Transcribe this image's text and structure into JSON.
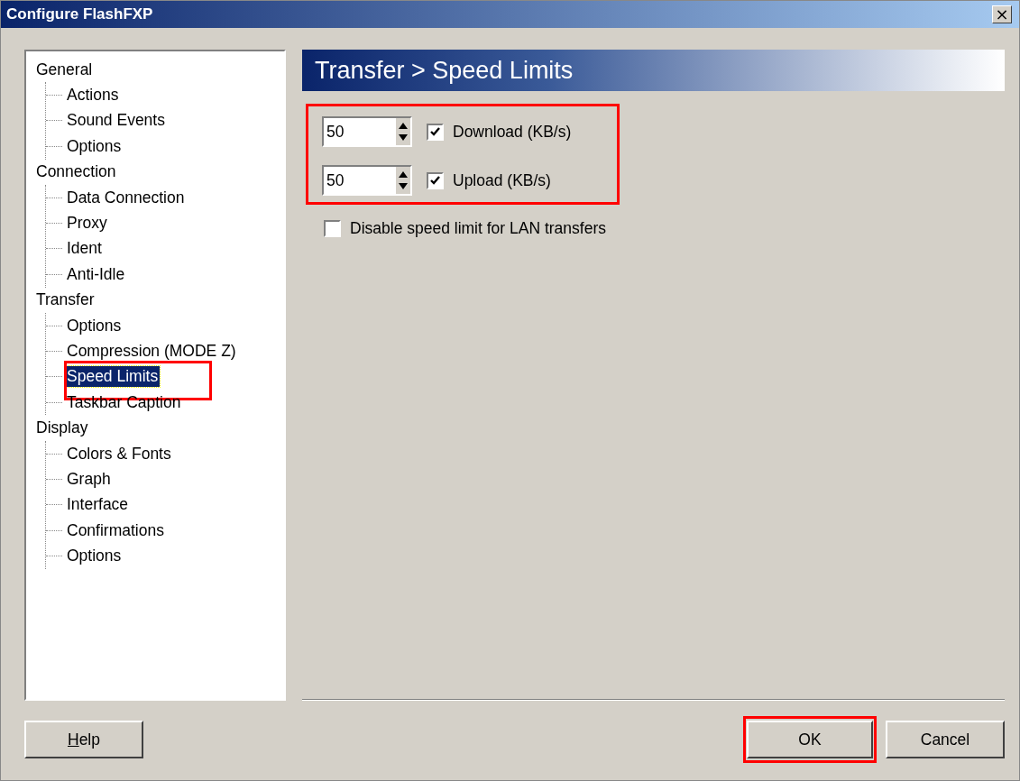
{
  "window": {
    "title": "Configure FlashFXP",
    "close": "×"
  },
  "tree": [
    {
      "label": "General",
      "selected": false,
      "children": [
        {
          "label": "Actions",
          "selected": false
        },
        {
          "label": "Sound Events",
          "selected": false
        },
        {
          "label": "Options",
          "selected": false
        }
      ]
    },
    {
      "label": "Connection",
      "selected": false,
      "children": [
        {
          "label": "Data Connection",
          "selected": false
        },
        {
          "label": "Proxy",
          "selected": false
        },
        {
          "label": "Ident",
          "selected": false
        },
        {
          "label": "Anti-Idle",
          "selected": false
        }
      ]
    },
    {
      "label": "Transfer",
      "selected": false,
      "children": [
        {
          "label": "Options",
          "selected": false
        },
        {
          "label": "Compression (MODE Z)",
          "selected": false
        },
        {
          "label": "Speed Limits",
          "selected": true,
          "highlighted": true
        },
        {
          "label": "Taskbar Caption",
          "selected": false
        }
      ]
    },
    {
      "label": "Display",
      "selected": false,
      "children": [
        {
          "label": "Colors & Fonts",
          "selected": false
        },
        {
          "label": "Graph",
          "selected": false
        },
        {
          "label": "Interface",
          "selected": false
        },
        {
          "label": "Confirmations",
          "selected": false
        },
        {
          "label": "Options",
          "selected": false
        }
      ]
    }
  ],
  "page_title": "Transfer > Speed Limits",
  "limits": {
    "highlighted": true,
    "rows": [
      {
        "value": "50",
        "checked": true,
        "label": "Download (KB/s)"
      },
      {
        "value": "50",
        "checked": true,
        "label": "Upload (KB/s)"
      }
    ]
  },
  "lan_option": {
    "checked": false,
    "label": "Disable speed limit for LAN transfers"
  },
  "buttons": [
    {
      "kind": "help",
      "accel": "H",
      "rest": "elp"
    },
    {
      "kind": "ok",
      "label": "OK",
      "highlighted": true
    },
    {
      "kind": "cancel",
      "label": "Cancel"
    }
  ]
}
